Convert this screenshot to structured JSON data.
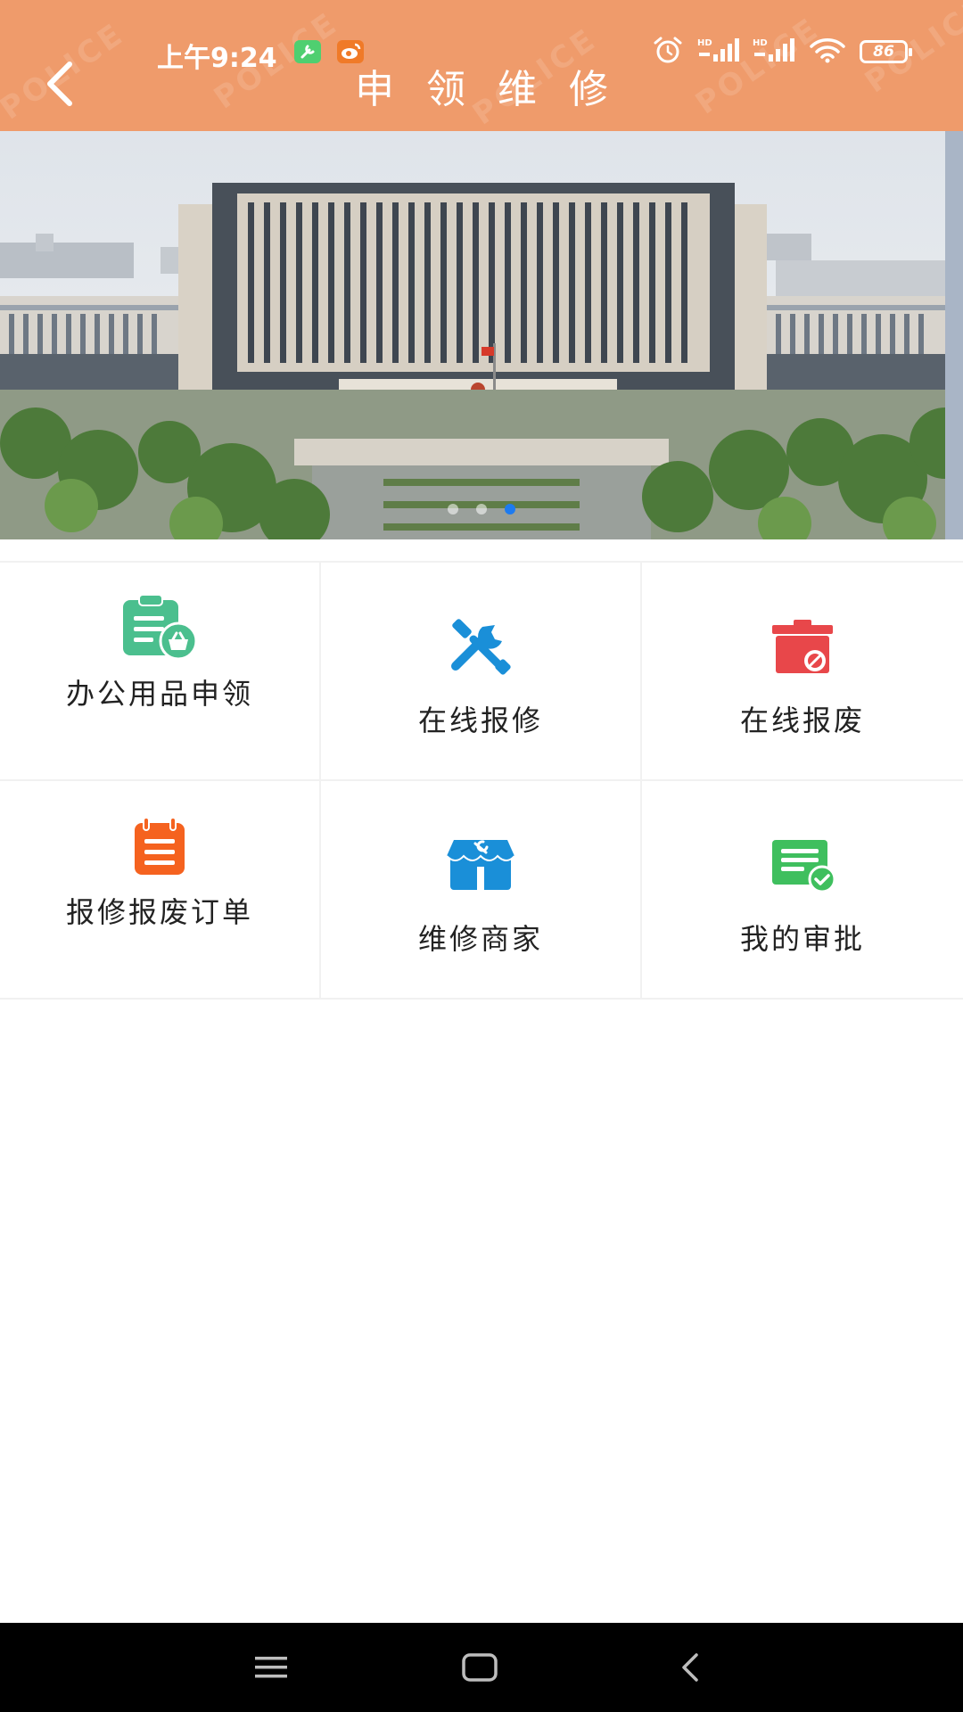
{
  "status_bar": {
    "time": "上午9:24",
    "battery": "86",
    "icons": [
      "alarm-icon",
      "hd-signal-icon",
      "hd-signal-icon",
      "wifi-icon",
      "battery-icon"
    ],
    "app_icons": [
      "wrench-app-icon",
      "weibo-app-icon"
    ]
  },
  "header": {
    "title": "申领维修",
    "back_icon": "chevron-left-icon",
    "background": "#ef9b6b",
    "watermark": "POLICE"
  },
  "banner": {
    "image": "government-building-photo",
    "dots": 3,
    "active_dot": 2
  },
  "menu": {
    "items": [
      {
        "label": "办公用品申领",
        "icon": "clipboard-basket-icon",
        "color": "#4bbf8e"
      },
      {
        "label": "在线报修",
        "icon": "tools-icon",
        "color": "#1a8fd8"
      },
      {
        "label": "在线报废",
        "icon": "trash-icon",
        "color": "#e8474a"
      },
      {
        "label": "报修报废订单",
        "icon": "order-list-icon",
        "color": "#f5621f"
      },
      {
        "label": "维修商家",
        "icon": "repair-shop-icon",
        "color": "#1a8fd8"
      },
      {
        "label": "我的审批",
        "icon": "approval-icon",
        "color": "#3fbf5e"
      }
    ]
  },
  "navbar": {
    "icons": [
      "menu-icon",
      "home-icon",
      "back-icon"
    ]
  }
}
